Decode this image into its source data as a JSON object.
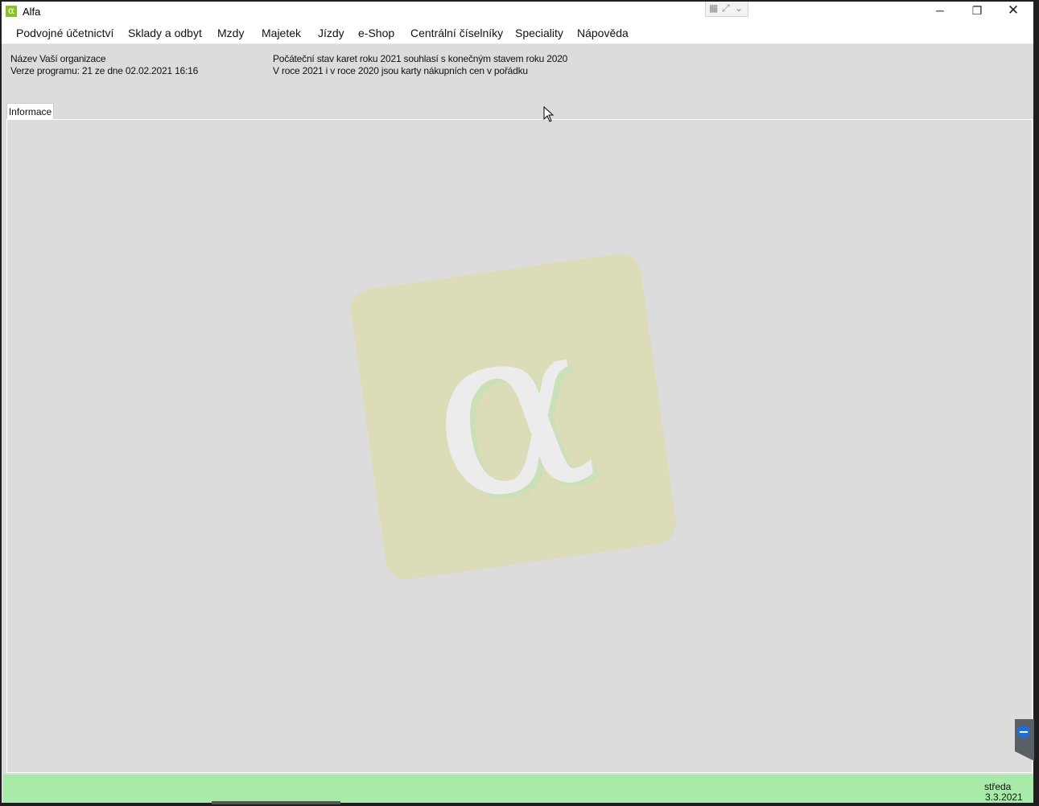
{
  "window": {
    "title": "Alfa"
  },
  "menu": [
    "Podvojné účetnictví",
    "Sklady a odbyt",
    "Mzdy",
    "Majetek",
    "Jízdy",
    "e-Shop",
    "Centrální číselníky",
    "Speciality",
    "Nápověda"
  ],
  "info": {
    "org_name": "Název Vaší organizace",
    "version": "Verze programu: 21 ze dne 02.02.2021 16:16",
    "status_line1": "Počáteční stav karet roku 2021 souhlasí s konečným stavem roku 2020",
    "status_line2": "V roce 2021 i v roce 2020 jsou karty nákupních cen v pořádku"
  },
  "tabs": [
    "Informace"
  ],
  "status_bar": {
    "day": "středa",
    "date": "3.3.2021"
  },
  "colors": {
    "status_bar": "#a8eaa8",
    "logo_bg": "#dcdcb8",
    "app_icon": "#8bc220"
  },
  "icons": {
    "app": "alpha-icon",
    "minimize": "minimize-icon",
    "restore": "restore-icon",
    "close": "close-icon",
    "watermark": "alpha-logo-icon"
  }
}
